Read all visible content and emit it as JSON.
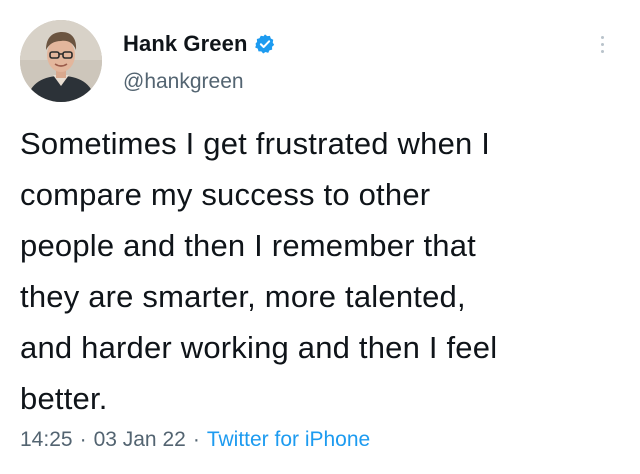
{
  "author": {
    "display_name": "Hank Green",
    "handle": "@hankgreen",
    "verified": true,
    "avatar_icon": "profile-photo",
    "verified_icon": "verified-badge-icon",
    "verified_color": "#1d9bf0"
  },
  "more_icon": "more-options-icon",
  "tweet": {
    "text": "Sometimes I get frustrated when I\ncompare my success to other\npeople and then I remember that\nthey are smarter, more talented,\nand harder working and then I feel\nbetter."
  },
  "meta": {
    "time": "14:25",
    "separator": "·",
    "date": "03 Jan 22",
    "source": "Twitter for iPhone",
    "source_color": "#1d9bf0"
  }
}
